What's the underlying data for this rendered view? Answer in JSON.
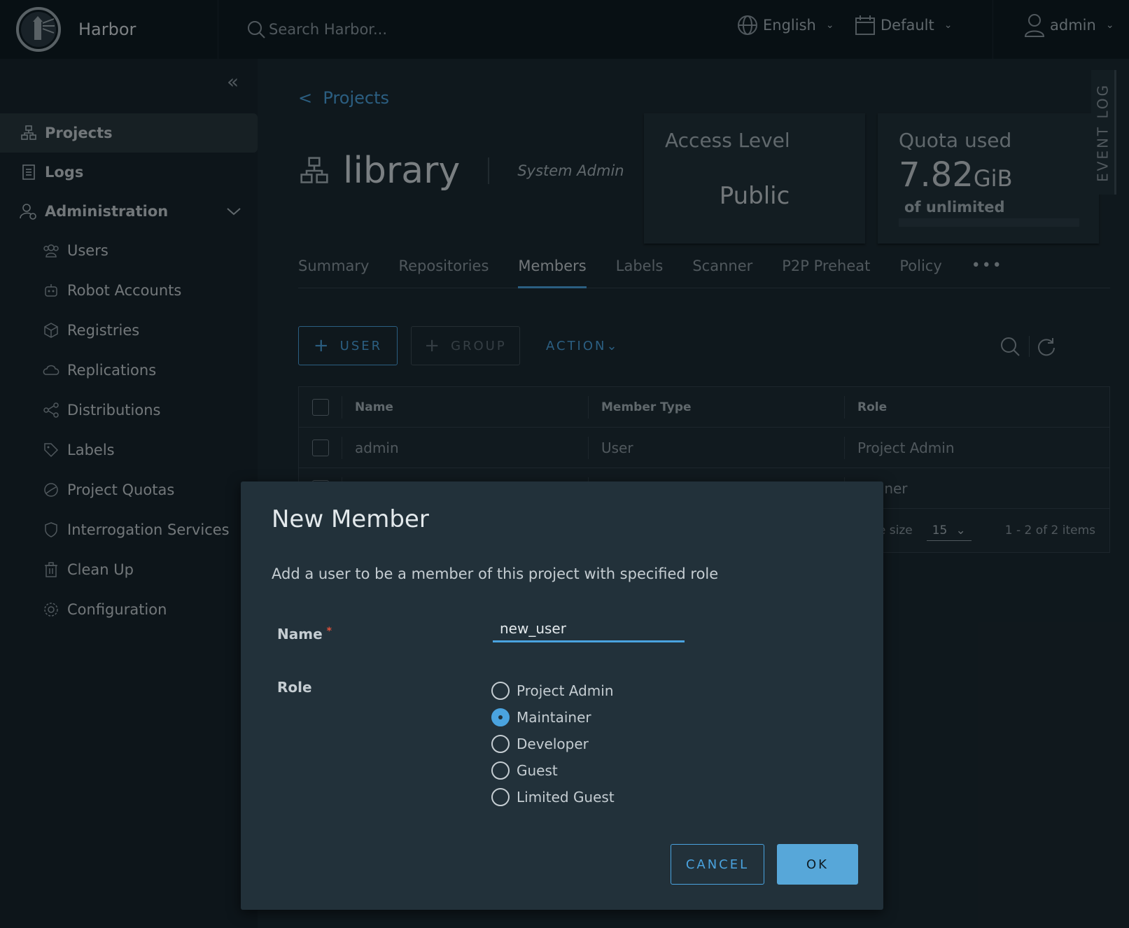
{
  "header": {
    "brand": "Harbor",
    "search_placeholder": "Search Harbor...",
    "language": "English",
    "theme": "Default",
    "user": "admin"
  },
  "sidebar": {
    "items": [
      {
        "label": "Projects",
        "icon": "projects-icon"
      },
      {
        "label": "Logs",
        "icon": "logs-icon"
      },
      {
        "label": "Administration",
        "icon": "administration-icon"
      },
      {
        "label": "Users",
        "icon": "users-icon"
      },
      {
        "label": "Robot Accounts",
        "icon": "robot-icon"
      },
      {
        "label": "Registries",
        "icon": "registries-icon"
      },
      {
        "label": "Replications",
        "icon": "replications-icon"
      },
      {
        "label": "Distributions",
        "icon": "distributions-icon"
      },
      {
        "label": "Labels",
        "icon": "labels-icon"
      },
      {
        "label": "Project Quotas",
        "icon": "quotas-icon"
      },
      {
        "label": "Interrogation Services",
        "icon": "shield-icon"
      },
      {
        "label": "Clean Up",
        "icon": "trash-icon"
      },
      {
        "label": "Configuration",
        "icon": "gear-icon"
      }
    ]
  },
  "main": {
    "back_link": "Projects",
    "project_name": "library",
    "project_role": "System Admin",
    "access_card": {
      "title": "Access Level",
      "value": "Public"
    },
    "quota_card": {
      "title": "Quota used",
      "value": "7.82",
      "unit": "GiB",
      "subtitle": "of unlimited"
    },
    "event_log": "EVENT LOG",
    "tabs": [
      "Summary",
      "Repositories",
      "Members",
      "Labels",
      "Scanner",
      "P2P Preheat",
      "Policy"
    ],
    "active_tab": "Members",
    "buttons": {
      "user": "USER",
      "group": "GROUP",
      "action": "ACTION"
    },
    "grid": {
      "columns": [
        "Name",
        "Member Type",
        "Role"
      ],
      "rows": [
        {
          "name": "admin",
          "type": "User",
          "role": "Project Admin"
        },
        {
          "name": "",
          "type": "",
          "role": "ntainer"
        }
      ],
      "page_size_label": "ge size",
      "page_size": "15",
      "count": "1 - 2 of 2 items"
    }
  },
  "modal": {
    "title": "New Member",
    "description": "Add a user to be a member of this project with specified role",
    "name_label": "Name",
    "name_value": "new_user",
    "role_label": "Role",
    "roles": [
      "Project Admin",
      "Maintainer",
      "Developer",
      "Guest",
      "Limited Guest"
    ],
    "selected_role": "Maintainer",
    "cancel": "CANCEL",
    "ok": "OK"
  },
  "colors": {
    "accent": "#4aa3df",
    "header_bg": "#0f1c24",
    "sidebar_bg": "#17252d",
    "modal_bg": "#22313a",
    "required": "#e0523a"
  }
}
